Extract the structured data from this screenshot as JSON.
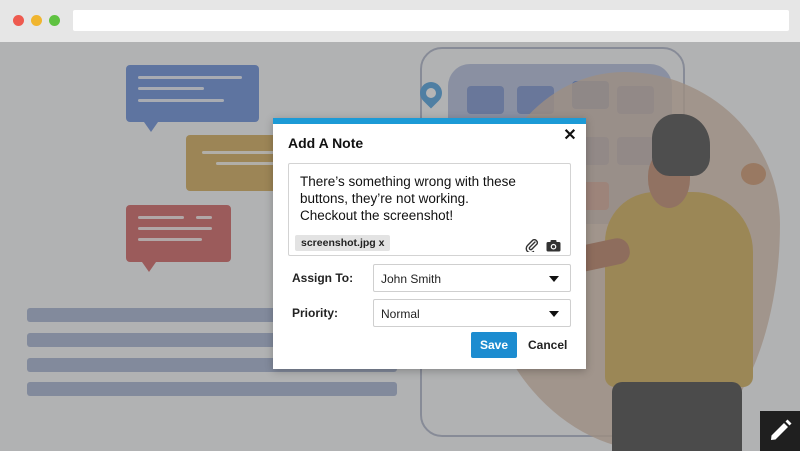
{
  "browser": {
    "url": ""
  },
  "modal": {
    "title": "Add A Note",
    "close_icon": "close-icon",
    "note_text": "There’s something wrong with these\nbuttons, they’re not working.\nCheckout the screenshot!",
    "attachment": "screenshot.jpg x",
    "icons": [
      "paperclip-icon",
      "camera-icon"
    ],
    "assign_label": "Assign To:",
    "assign_value": "John Smith",
    "priority_label": "Priority:",
    "priority_value": "Normal",
    "save_label": "Save",
    "cancel_label": "Cancel"
  },
  "fab": {
    "icon": "pencil-icon"
  },
  "colors": {
    "accent": "#1c9ad6",
    "save_button": "#1c8cd0",
    "bubble_blue": "#3f6fd1",
    "bubble_gold": "#c8962d",
    "bubble_red": "#c63838"
  }
}
